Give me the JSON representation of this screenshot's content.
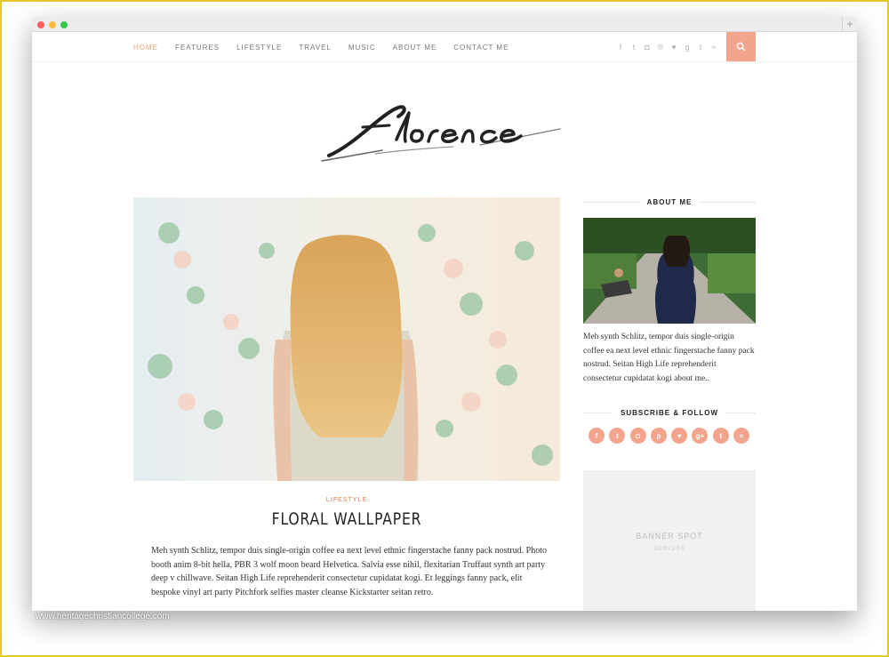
{
  "nav": {
    "items": [
      {
        "label": "HOME",
        "active": true
      },
      {
        "label": "FEATURES",
        "active": false
      },
      {
        "label": "LIFESTYLE",
        "active": false
      },
      {
        "label": "TRAVEL",
        "active": false
      },
      {
        "label": "MUSIC",
        "active": false
      },
      {
        "label": "ABOUT ME",
        "active": false
      },
      {
        "label": "CONTACT ME",
        "active": false
      }
    ],
    "social_icons": [
      "facebook-icon",
      "twitter-icon",
      "instagram-icon",
      "pinterest-icon",
      "heart-icon",
      "google-plus-icon",
      "tumblr-icon",
      "rss-icon"
    ],
    "search_icon": "search-icon"
  },
  "logo": {
    "text": "florence"
  },
  "post": {
    "category": "LIFESTYLE",
    "title": "FLORAL WALLPAPER",
    "excerpt": "Meh synth Schlitz, tempor duis single-origin coffee ea next level ethnic fingerstache fanny pack nostrud. Photo booth anim 8-bit hella, PBR 3 wolf moon beard Helvetica. Salvia esse nihil, flexitarian Truffaut synth art party deep v chillwave. Seitan High Life reprehenderit consectetur cupidatat kogi. Et leggings fanny pack, elit bespoke vinyl art party Pitchfork selfies master cleanse Kickstarter seitan retro."
  },
  "sidebar": {
    "about_title": "ABOUT ME",
    "about_text": "Meh synth Schlitz, tempor duis single-origin coffee ea next level ethnic fingerstache fanny pack nostrud. Seitan High Life reprehenderit consectetur cupidatat kogi about me..",
    "follow_title": "SUBSCRIBE & FOLLOW",
    "follow_icons": [
      "facebook-icon",
      "twitter-icon",
      "instagram-icon",
      "pinterest-icon",
      "heart-icon",
      "google-plus-icon",
      "tumblr-icon",
      "rss-icon"
    ],
    "banner_label": "BANNER SPOT",
    "banner_size": "300x250"
  },
  "watermark": "www.heritagechristiancollege.com",
  "colors": {
    "accent": "#f3a48c",
    "nav_active": "#e8a27a",
    "frame": "#e8c62e"
  }
}
